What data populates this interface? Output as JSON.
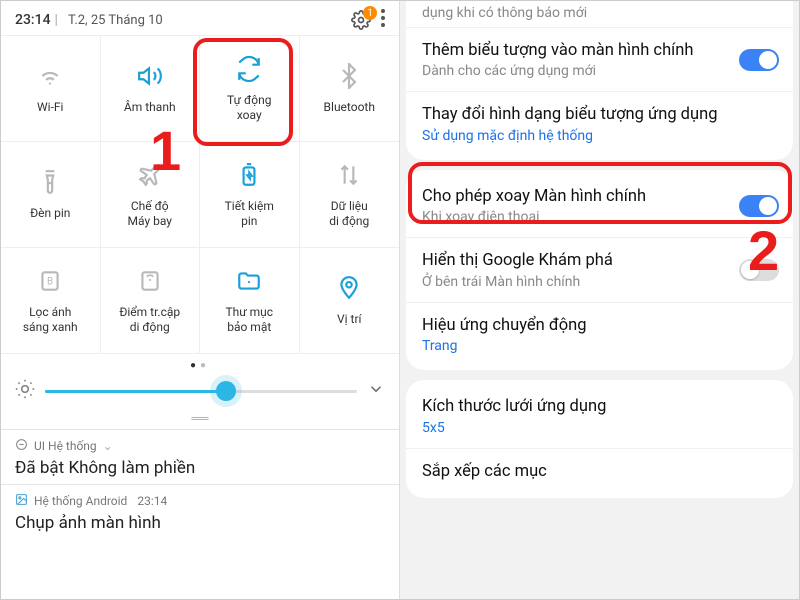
{
  "status": {
    "time": "23:14",
    "date": "T.2, 25 Tháng 10",
    "badge": "1"
  },
  "qs": [
    {
      "label": "Wi-Fi"
    },
    {
      "label": "Âm thanh"
    },
    {
      "label": "Tự động\nxoay"
    },
    {
      "label": "Bluetooth"
    },
    {
      "label": "Đèn pin"
    },
    {
      "label": "Chế độ\nMáy bay"
    },
    {
      "label": "Tiết kiệm\npin"
    },
    {
      "label": "Dữ liệu\ndi động"
    },
    {
      "label": "Lọc ánh\nsáng xanh"
    },
    {
      "label": "Điểm tr.cập\ndi động"
    },
    {
      "label": "Thư mục\nbảo mật"
    },
    {
      "label": "Vị trí"
    }
  ],
  "notif1": {
    "app": "UI Hệ thống",
    "body": "Đã bật Không làm phiền"
  },
  "notif2": {
    "app": "Hệ thống Android",
    "time": "23:14",
    "body": "Chụp ảnh màn hình"
  },
  "right_cut": "dụng khi có thông báo mới",
  "settings": {
    "s0": {
      "title": "Thêm biểu tượng vào màn hình chính",
      "sub": "Dành cho các ứng dụng mới"
    },
    "s1": {
      "title": "Thay đổi hình dạng biểu tượng ứng dụng",
      "sub": "Sử dụng mặc định hệ thống"
    },
    "s2": {
      "title": "Cho phép xoay Màn hình chính",
      "sub": "Khi xoay điện thoại"
    },
    "s3": {
      "title": "Hiển thị Google Khám phá",
      "sub": "Ở bên trái Màn hình chính"
    },
    "s4": {
      "title": "Hiệu ứng chuyển động",
      "sub": "Trang"
    },
    "s5": {
      "title": "Kích thước lưới ứng dụng",
      "sub": "5x5"
    },
    "s6": {
      "title": "Sắp xếp các mục"
    }
  },
  "steps": {
    "one": "1",
    "two": "2"
  }
}
